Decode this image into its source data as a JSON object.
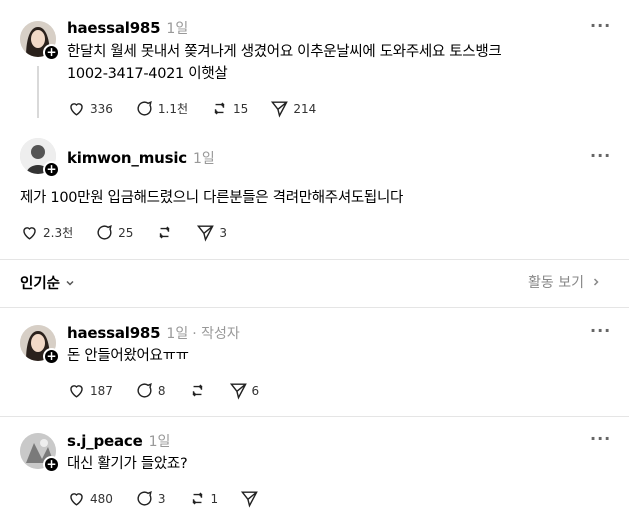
{
  "posts": [
    {
      "username": "haessal985",
      "time": "1일",
      "lines": [
        "한달치 월세 못내서 쫒겨나게 생겼어요 이추운날씨에 도와주세요 토스뱅크",
        "1002-3417-4021 이햇살"
      ],
      "likes": "336",
      "comments": "1.1천",
      "reposts": "15",
      "shares": "214"
    },
    {
      "username": "kimwon_music",
      "time": "1일",
      "lines": [
        "제가 100만원 입금해드렸으니 다른분들은 격려만해주셔도됩니다"
      ],
      "likes": "2.3천",
      "comments": "25",
      "reposts": "",
      "shares": "3"
    }
  ],
  "sort_bar": {
    "label": "인기순",
    "activity_label": "활동 보기"
  },
  "replies": [
    {
      "username": "haessal985",
      "time": "1일",
      "author_tag": "· 작성자",
      "text": "돈 안들어왔어요ㅠㅠ",
      "likes": "187",
      "comments": "8",
      "reposts": "",
      "shares": "6"
    },
    {
      "username": "s.j_peace",
      "time": "1일",
      "text": "대신 활기가 들았죠?",
      "likes": "480",
      "comments": "3",
      "reposts": "1",
      "shares": ""
    }
  ],
  "icons": {
    "like": "heart-icon",
    "comment": "comment-icon",
    "repost": "repost-icon",
    "share": "share-icon",
    "more": "more-icon",
    "follow": "plus-icon",
    "chevron": "chevron-down-icon"
  }
}
